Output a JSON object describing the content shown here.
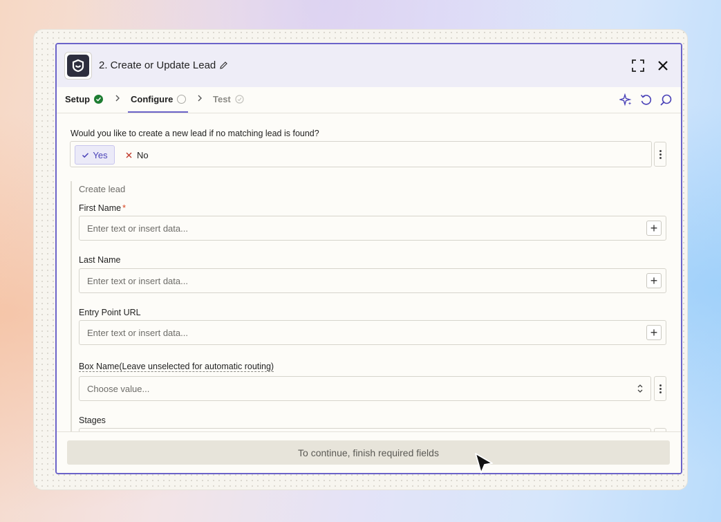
{
  "header": {
    "step_title": "2. Create or Update Lead",
    "expand_icon": "expand-icon",
    "close_icon": "close-icon"
  },
  "tabs": [
    {
      "label": "Setup",
      "status": "complete"
    },
    {
      "label": "Configure",
      "status": "active"
    },
    {
      "label": "Test",
      "status": "pending"
    }
  ],
  "question": {
    "label": "Would you like to create a new lead if no matching lead is found?",
    "yes_label": "Yes",
    "no_label": "No",
    "selected": "Yes"
  },
  "create_lead": {
    "group_title": "Create lead",
    "first_name": {
      "label": "First Name",
      "required_mark": "*",
      "placeholder": "Enter text or insert data..."
    },
    "last_name": {
      "label": "Last Name",
      "placeholder": "Enter text or insert data..."
    },
    "entry_point_url": {
      "label": "Entry Point URL",
      "placeholder": "Enter text or insert data..."
    },
    "box_name": {
      "label": "Box Name(Leave unselected for automatic routing)",
      "placeholder": "Choose value..."
    },
    "stages": {
      "label": "Stages"
    }
  },
  "footer": {
    "continue_label": "To continue, finish required fields"
  },
  "colors": {
    "accent": "#6b63c9",
    "success": "#1e7d32",
    "required": "#d8431e"
  }
}
